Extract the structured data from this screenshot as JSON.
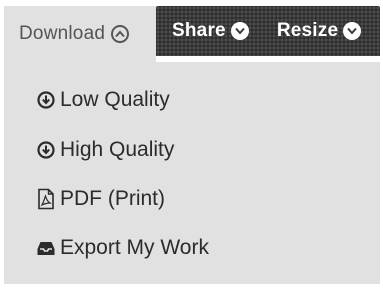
{
  "tabs": {
    "download": {
      "label": "Download",
      "icon": "chevron-up-circle-icon"
    },
    "share": {
      "label": "Share",
      "icon": "chevron-down-circle-icon"
    },
    "resize": {
      "label": "Resize",
      "icon": "chevron-down-circle-icon"
    }
  },
  "menu": {
    "items": [
      {
        "label": "Low Quality",
        "icon": "download-circle-icon"
      },
      {
        "label": "High Quality",
        "icon": "download-circle-icon"
      },
      {
        "label": "PDF (Print)",
        "icon": "pdf-file-icon"
      },
      {
        "label": "Export My Work",
        "icon": "inbox-tray-icon"
      }
    ]
  },
  "colors": {
    "panel_bg": "#e1e1e1",
    "dark_tab_bg": "#3b3b3b",
    "text": "#2b2b2b"
  }
}
